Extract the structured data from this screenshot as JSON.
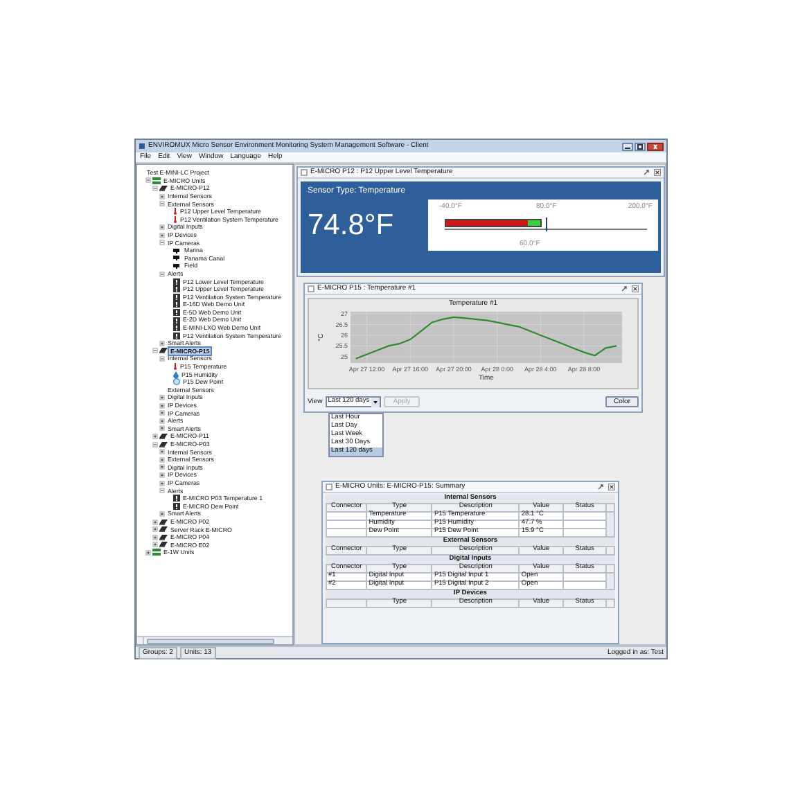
{
  "window": {
    "title": "ENVIROMUX Micro Sensor Environment Monitoring System Management Software - Client"
  },
  "menu": [
    "File",
    "Edit",
    "View",
    "Window",
    "Language",
    "Help"
  ],
  "tree": [
    {
      "label": "Test E-MINI-LC Project",
      "selected": false,
      "children": [
        {
          "label": "E-MICRO Units",
          "kind": "group",
          "expanded": true,
          "selected": false,
          "children": [
            {
              "label": "E-MICRO-P12",
              "kind": "unit",
              "expanded": true,
              "selected": false,
              "children": [
                {
                  "label": "Internal Sensors",
                  "expanded": false,
                  "selected": false
                },
                {
                  "label": "External Sensors",
                  "expanded": true,
                  "selected": false,
                  "children": [
                    {
                      "label": "P12 Upper Level Temperature",
                      "kind": "temperature",
                      "selected": false
                    },
                    {
                      "label": "P12 Ventilation System Temperature",
                      "kind": "temperature",
                      "selected": false
                    }
                  ]
                },
                {
                  "label": "Digital Inputs",
                  "expanded": false,
                  "selected": false
                },
                {
                  "label": "IP Devices",
                  "expanded": false,
                  "selected": false
                },
                {
                  "label": "IP Cameras",
                  "expanded": true,
                  "selected": false,
                  "children": [
                    {
                      "label": "Marina",
                      "kind": "camera",
                      "selected": false
                    },
                    {
                      "label": "Panama Canal",
                      "kind": "camera",
                      "selected": false
                    },
                    {
                      "label": "Field",
                      "kind": "camera",
                      "selected": false
                    }
                  ]
                },
                {
                  "label": "Alerts",
                  "expanded": true,
                  "selected": false,
                  "children": [
                    {
                      "label": "P12 Lower Level Temperature",
                      "kind": "alert",
                      "selected": false
                    },
                    {
                      "label": "P12 Upper Level Temperature",
                      "kind": "alert",
                      "selected": false
                    },
                    {
                      "label": "P12 Ventilation System Temperature",
                      "kind": "alert",
                      "selected": false
                    },
                    {
                      "label": "E-16D Web Demo Unit",
                      "kind": "alert",
                      "selected": false
                    },
                    {
                      "label": "E-5D Web Demo Unit",
                      "kind": "alert",
                      "selected": false
                    },
                    {
                      "label": "E-2D Web Demo Unit",
                      "kind": "alert",
                      "selected": false
                    },
                    {
                      "label": "E-MINI-LXO Web Demo Unit",
                      "kind": "alert",
                      "selected": false
                    },
                    {
                      "label": "P12 Ventilation System Temperature",
                      "kind": "alert",
                      "selected": false
                    }
                  ]
                },
                {
                  "label": "Smart Alerts",
                  "expanded": false,
                  "selected": false
                }
              ]
            },
            {
              "label": "E-MICRO-P15",
              "kind": "unit",
              "expanded": true,
              "selected": true,
              "children": [
                {
                  "label": "Internal Sensors",
                  "expanded": true,
                  "selected": false,
                  "children": [
                    {
                      "label": "P15 Temperature",
                      "kind": "temperature",
                      "selected": false
                    },
                    {
                      "label": "P15 Humidity",
                      "kind": "humidity",
                      "selected": false
                    },
                    {
                      "label": "P15 Dew Point",
                      "kind": "dewpoint",
                      "selected": false
                    }
                  ]
                },
                {
                  "label": "External Sensors",
                  "selected": false
                },
                {
                  "label": "Digital Inputs",
                  "expanded": false,
                  "selected": false
                },
                {
                  "label": "IP Devices",
                  "expanded": false,
                  "selected": false
                },
                {
                  "label": "IP Cameras",
                  "expanded": false,
                  "selected": false
                },
                {
                  "label": "Alerts",
                  "expanded": false,
                  "selected": false
                },
                {
                  "label": "Smart Alerts",
                  "expanded": false,
                  "selected": false
                }
              ]
            },
            {
              "label": "E-MICRO-P11",
              "kind": "unit",
              "expanded": false,
              "selected": false
            },
            {
              "label": "E-MICRO-P03",
              "kind": "unit",
              "expanded": true,
              "selected": false,
              "children": [
                {
                  "label": "Internal Sensors",
                  "expanded": false,
                  "selected": false
                },
                {
                  "label": "External Sensors",
                  "expanded": false,
                  "selected": false
                },
                {
                  "label": "Digital Inputs",
                  "expanded": false,
                  "selected": false
                },
                {
                  "label": "IP Devices",
                  "expanded": false,
                  "selected": false
                },
                {
                  "label": "IP Cameras",
                  "expanded": false,
                  "selected": false
                },
                {
                  "label": "Alerts",
                  "expanded": true,
                  "selected": false,
                  "children": [
                    {
                      "label": "E-MICRO P03 Temperature 1",
                      "kind": "alert",
                      "selected": false
                    },
                    {
                      "label": "E-MICRO Dew Point",
                      "kind": "alert",
                      "selected": false
                    }
                  ]
                },
                {
                  "label": "Smart Alerts",
                  "expanded": false,
                  "selected": false
                }
              ]
            },
            {
              "label": "E-MICRO P02",
              "kind": "unit",
              "expanded": false,
              "selected": false
            },
            {
              "label": "Server Rack E-MICRO",
              "kind": "unit",
              "expanded": false,
              "selected": false
            },
            {
              "label": "E-MICRO P04",
              "kind": "unit",
              "expanded": false,
              "selected": false
            },
            {
              "label": "E-MICRO E02",
              "kind": "unit",
              "expanded": false,
              "selected": false
            }
          ]
        },
        {
          "label": "E-1W Units",
          "kind": "group",
          "expanded": false,
          "selected": false
        }
      ]
    }
  ],
  "status_bar": {
    "groups": "Groups: 2",
    "units": "Units: 13",
    "user": "Logged in as: Test"
  },
  "sensor_window": {
    "title": "E-MICRO P12 : P12 Upper Level Temperature",
    "sensor_type": "Sensor Type: Temperature",
    "reading": "74.8°F",
    "gauge": {
      "min_label": "-40.0°F",
      "high_label": "80.0°F",
      "max_label": "200.0°F",
      "low_label": "60.0°F",
      "level": 0.48
    }
  },
  "chart_window": {
    "title": "E-MICRO P15 : Temperature #1",
    "chart_data": {
      "type": "line",
      "title": "Temperature #1",
      "xlabel": "Time",
      "ylabel": "°C",
      "grid": true,
      "categories": [
        null,
        "Apr 27 12:00",
        null,
        null,
        null,
        "Apr 27 16:00",
        null,
        null,
        null,
        "Apr 27 20:00",
        null,
        null,
        null,
        "Apr 28 0:00",
        null,
        null,
        null,
        "Apr 28 4:00",
        null,
        null,
        null,
        "Apr 28 8:00",
        null,
        null,
        null
      ],
      "series": [
        {
          "color": "#2e8b2e",
          "values": [
            24.9,
            25.1,
            25.3,
            25.5,
            25.6,
            25.8,
            26.2,
            26.6,
            26.75,
            26.85,
            26.8,
            26.75,
            26.7,
            26.6,
            26.5,
            26.4,
            26.2,
            26,
            25.8,
            25.6,
            25.4,
            25.2,
            25.05,
            25.4,
            25.5
          ]
        }
      ],
      "ylim": [
        24.7,
        27.1
      ],
      "yticks": [
        25,
        25.5,
        26,
        26.5,
        27
      ]
    },
    "view_label": "View",
    "view_value": "Last 120 days",
    "view_options": [
      {
        "label": "Last Hour",
        "selected": false
      },
      {
        "label": "Last Day",
        "selected": false
      },
      {
        "label": "Last Week",
        "selected": false
      },
      {
        "label": "Last 30 Days",
        "selected": false
      },
      {
        "label": "Last 120 days",
        "selected": true
      }
    ],
    "apply": {
      "label": "Apply",
      "disabled": true
    },
    "color_button": "Color"
  },
  "summary_window": {
    "title": "E-MICRO Units: E-MICRO-P15: Summary",
    "sections": [
      {
        "title": "Internal Sensors",
        "columns": [
          "Connector",
          "Type",
          "Description",
          "Value",
          "Status"
        ],
        "rows": [
          {
            "type": "Temperature",
            "description": "P15 Temperature",
            "value": "28.1 °C"
          },
          {
            "type": "Humidity",
            "description": "P15 Humidity",
            "value": "47.7 %"
          },
          {
            "type": "Dew Point",
            "description": "P15 Dew Point",
            "value": "15.9 °C"
          }
        ]
      },
      {
        "title": "External Sensors",
        "columns": [
          "Connector",
          "Type",
          "Description",
          "Value",
          "Status"
        ]
      },
      {
        "title": "Digital Inputs",
        "columns": [
          "Connector",
          "Type",
          "Description",
          "Value",
          "Status"
        ],
        "rows": [
          {
            "connector": "#1",
            "type": "Digital Input",
            "description": "P15 Digital Input  1",
            "value": "Open"
          },
          {
            "connector": "#2",
            "type": "Digital Input",
            "description": "P15 Digital Input  2",
            "value": "Open"
          }
        ]
      },
      {
        "title": "IP Devices",
        "columns": [
          "Type",
          "Description",
          "Value",
          "Status"
        ]
      }
    ]
  }
}
